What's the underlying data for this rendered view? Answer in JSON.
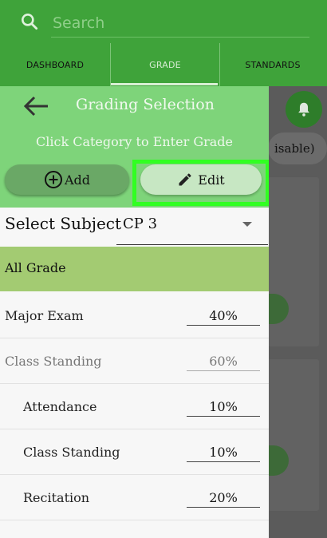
{
  "search": {
    "placeholder": "Search"
  },
  "tabs": [
    {
      "label": "DASHBOARD"
    },
    {
      "label": "GRADE"
    },
    {
      "label": "STANDARDS"
    }
  ],
  "background": {
    "pill_text": "isable)"
  },
  "drawer": {
    "title": "Grading Selection",
    "subtitle": "Click Category to Enter Grade",
    "add_label": "Add",
    "edit_label": "Edit",
    "subject_label": "Select Subject",
    "subject_value": "CP 3",
    "all_grade": "All Grade",
    "rows": [
      {
        "name": "Major Exam",
        "percent": "40%"
      },
      {
        "name": "Class Standing",
        "percent": "60%"
      },
      {
        "name": "Attendance",
        "percent": "10%"
      },
      {
        "name": "Class Standing",
        "percent": "10%"
      },
      {
        "name": "Recitation",
        "percent": "20%"
      }
    ]
  },
  "colors": {
    "header_green": "#3fa33a",
    "drawer_green": "#7ed47a",
    "highlight": "#31ff22",
    "all_grade_bg": "#a3cb72"
  }
}
